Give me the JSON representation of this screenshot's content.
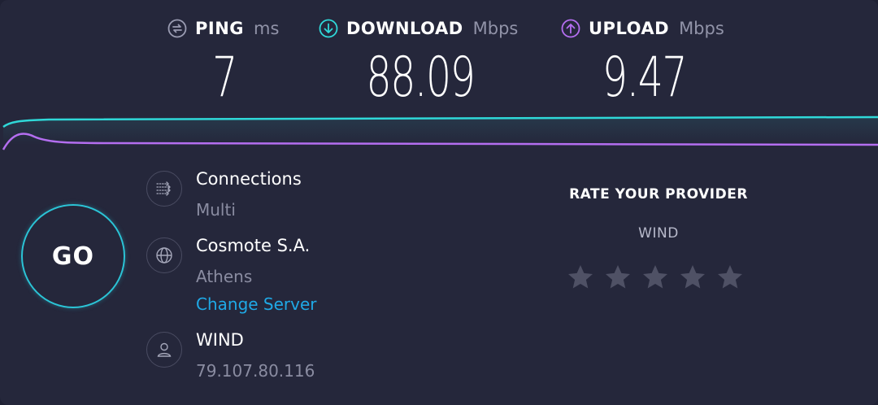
{
  "metrics": {
    "ping": {
      "title": "PING",
      "unit": "ms",
      "value": "7",
      "icon": "ping-icon"
    },
    "download": {
      "title": "DOWNLOAD",
      "unit": "Mbps",
      "value": "88.09",
      "icon": "download-arrow-icon"
    },
    "upload": {
      "title": "UPLOAD",
      "unit": "Mbps",
      "value": "9.47",
      "icon": "upload-arrow-icon"
    }
  },
  "colors": {
    "background": "#25273b",
    "download_accent": "#2fd8d8",
    "upload_accent": "#b46ef0",
    "go_ring": "#2bc4d6",
    "link": "#1fa9e6",
    "star": "#4f5165"
  },
  "go_button": {
    "label": "GO"
  },
  "connections": {
    "label": "Connections",
    "value": "Multi",
    "icon": "connections-icon"
  },
  "server": {
    "name": "Cosmote S.A.",
    "location": "Athens",
    "change_label": "Change Server",
    "icon": "globe-icon"
  },
  "isp": {
    "name": "WIND",
    "ip": "79.107.80.116",
    "icon": "user-icon"
  },
  "rating": {
    "title": "RATE YOUR PROVIDER",
    "provider": "WIND",
    "max_stars": 5,
    "selected": 0
  }
}
